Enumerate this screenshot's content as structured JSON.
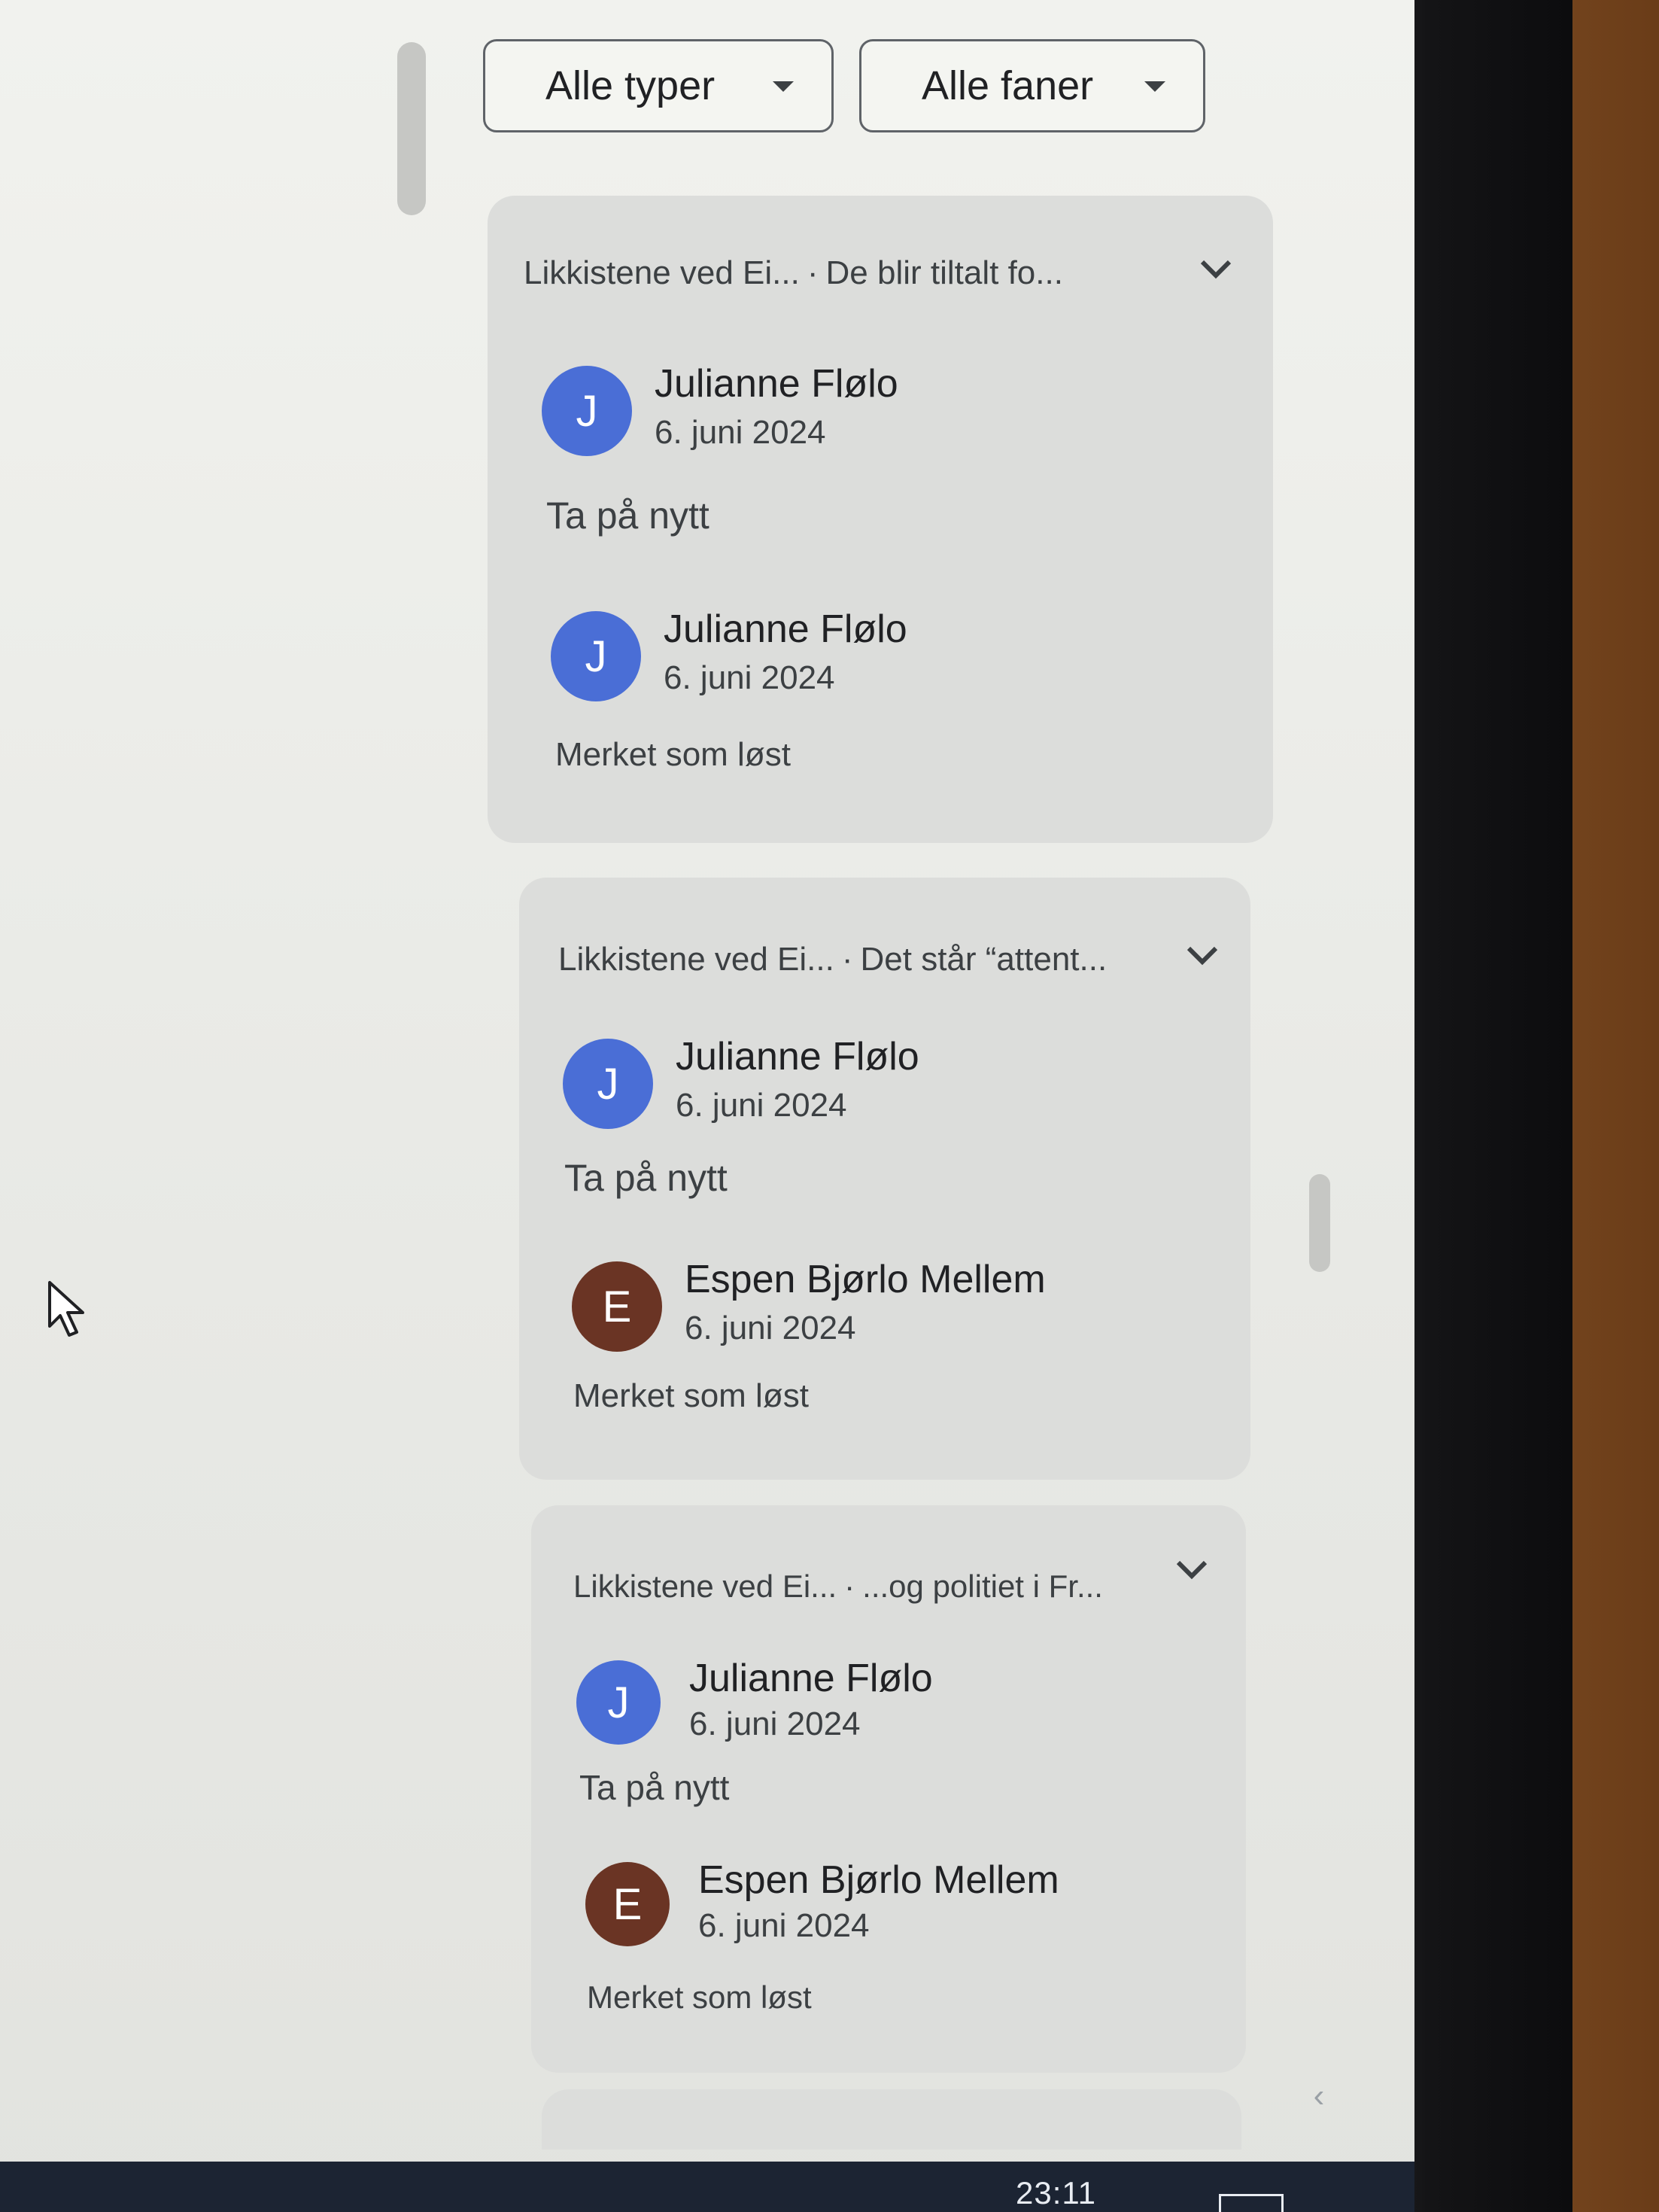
{
  "filters": {
    "type_label": "Alle typer",
    "tab_label": "Alle faner"
  },
  "cards": [
    {
      "title": "Likkistene ved Ei...",
      "excerpt": "De blir tiltalt fo...",
      "reopen": {
        "author": "Julianne Fløl​o",
        "avatar_letter": "J",
        "date": "6. juni 2024",
        "action": "Ta på nytt"
      },
      "resolve": {
        "author": "Julianne Fløl​o",
        "avatar_letter": "J",
        "date": "6. juni 2024",
        "action": "Merket som løst"
      }
    },
    {
      "title": "Likkistene ved Ei...",
      "excerpt": "Det står “attent...",
      "reopen": {
        "author": "Julianne Fløl​o",
        "avatar_letter": "J",
        "date": "6. juni 2024",
        "action": "Ta på nytt"
      },
      "resolve": {
        "author": "Espen Bjørlo Mellem",
        "avatar_letter": "E",
        "date": "6. juni 2024",
        "action": "Merket som løst"
      }
    },
    {
      "title": "Likkistene ved Ei...",
      "excerpt": "...og politiet i Fr...",
      "reopen": {
        "author": "Julianne Fløl​o",
        "avatar_letter": "J",
        "date": "6. juni 2024",
        "action": "Ta på nytt"
      },
      "resolve": {
        "author": "Espen Bjørlo Mellem",
        "avatar_letter": "E",
        "date": "6. juni 2024",
        "action": "Merket som løst"
      }
    }
  ],
  "taskbar": {
    "time": "23:11"
  },
  "colors": {
    "avatar_blue": "#4a6ed6",
    "avatar_brown": "#6a3424",
    "card_background": "#dcdddb"
  }
}
